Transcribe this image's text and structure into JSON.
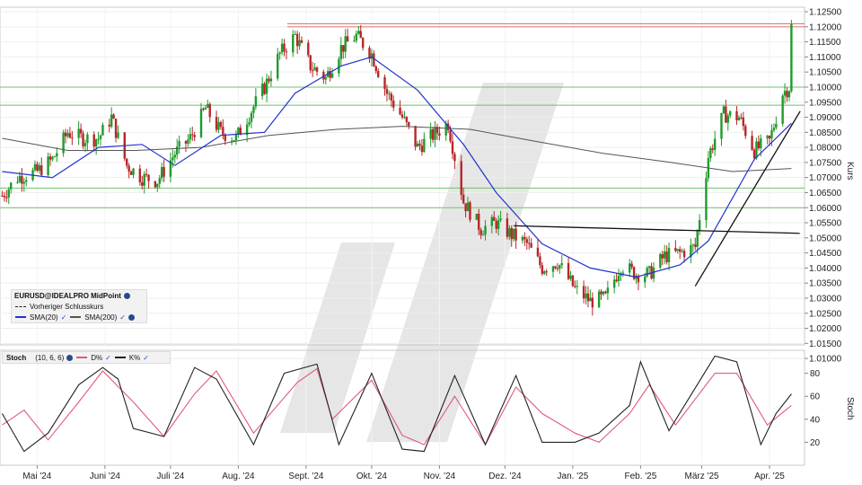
{
  "colors": {
    "bull": "#1f9b2a",
    "bear": "#b8262a",
    "sma20": "#2233cc",
    "sma200": "#555555",
    "support": "#6cc46c",
    "resistance": "#e07070",
    "trendline": "#111111",
    "stoch_k": "#222222",
    "stoch_d": "#e05a78",
    "watermark": "#e6e6e6"
  },
  "legend_main": {
    "title": "EURUSD@IDEALPRO MidPoint",
    "prev_close": "Vorheriger Schlusskurs",
    "sma20": "SMA(20)",
    "sma200": "SMA(200)"
  },
  "legend_stoch": {
    "title": "Stoch",
    "params": "(10, 6, 6)",
    "d_label": "D%",
    "k_label": "K%"
  },
  "chart_data": [
    {
      "type": "candlestick",
      "title": "EURUSD@IDEALPRO MidPoint",
      "ylabel": "Kurs",
      "ylim": [
        1.0145,
        1.1265
      ],
      "yticks": [
        "1.01000",
        "1.01500",
        "1.02000",
        "1.02500",
        "1.03000",
        "1.03500",
        "1.04000",
        "1.04500",
        "1.05000",
        "1.05500",
        "1.06000",
        "1.06500",
        "1.07000",
        "1.07500",
        "1.08000",
        "1.08500",
        "1.09000",
        "1.09500",
        "1.10000",
        "1.10500",
        "1.11000",
        "1.11500",
        "1.12000",
        "1.12500"
      ],
      "xticks": [
        "Mai '24",
        "Juni '24",
        "Juli '24",
        "Aug. '24",
        "Sept. '24",
        "Okt. '24",
        "Nov. '24",
        "Dez. '24",
        "Jan. '25",
        "Feb. '25",
        "März '25",
        "Apr. '25"
      ],
      "close_path": [
        [
          "2024-04-15",
          1.064
        ],
        [
          "2024-04-22",
          1.07
        ],
        [
          "2024-05-01",
          1.072
        ],
        [
          "2024-05-08",
          1.076
        ],
        [
          "2024-05-15",
          1.085
        ],
        [
          "2024-05-22",
          1.083
        ],
        [
          "2024-05-29",
          1.083
        ],
        [
          "2024-06-04",
          1.09
        ],
        [
          "2024-06-11",
          1.074
        ],
        [
          "2024-06-18",
          1.07
        ],
        [
          "2024-06-25",
          1.069
        ],
        [
          "2024-07-03",
          1.078
        ],
        [
          "2024-07-10",
          1.083
        ],
        [
          "2024-07-17",
          1.093
        ],
        [
          "2024-07-24",
          1.085
        ],
        [
          "2024-07-31",
          1.083
        ],
        [
          "2024-08-06",
          1.091
        ],
        [
          "2024-08-13",
          1.1
        ],
        [
          "2024-08-20",
          1.111
        ],
        [
          "2024-08-27",
          1.117
        ],
        [
          "2024-09-03",
          1.107
        ],
        [
          "2024-09-10",
          1.103
        ],
        [
          "2024-09-17",
          1.113
        ],
        [
          "2024-09-24",
          1.117
        ],
        [
          "2024-10-01",
          1.111
        ],
        [
          "2024-10-08",
          1.098
        ],
        [
          "2024-10-15",
          1.09
        ],
        [
          "2024-10-22",
          1.08
        ],
        [
          "2024-10-29",
          1.084
        ],
        [
          "2024-11-05",
          1.088
        ],
        [
          "2024-11-12",
          1.062
        ],
        [
          "2024-11-20",
          1.053
        ],
        [
          "2024-11-27",
          1.055
        ],
        [
          "2024-12-04",
          1.051
        ],
        [
          "2024-12-11",
          1.048
        ],
        [
          "2024-12-18",
          1.04
        ],
        [
          "2024-12-25",
          1.042
        ],
        [
          "2025-01-02",
          1.033
        ],
        [
          "2025-01-09",
          1.029
        ],
        [
          "2025-01-16",
          1.03
        ],
        [
          "2025-01-23",
          1.041
        ],
        [
          "2025-01-30",
          1.038
        ],
        [
          "2025-02-05",
          1.038
        ],
        [
          "2025-02-12",
          1.044
        ],
        [
          "2025-02-19",
          1.045
        ],
        [
          "2025-02-26",
          1.047
        ],
        [
          "2025-03-04",
          1.077
        ],
        [
          "2025-03-11",
          1.091
        ],
        [
          "2025-03-18",
          1.09
        ],
        [
          "2025-03-25",
          1.079
        ],
        [
          "2025-04-01",
          1.082
        ],
        [
          "2025-04-07",
          1.098
        ],
        [
          "2025-04-10",
          1.1
        ],
        [
          "2025-04-11",
          1.12
        ]
      ],
      "sma20_path": [
        [
          "2024-04-15",
          1.072
        ],
        [
          "2024-05-08",
          1.07
        ],
        [
          "2024-05-29",
          1.08
        ],
        [
          "2024-06-18",
          1.081
        ],
        [
          "2024-07-03",
          1.074
        ],
        [
          "2024-07-24",
          1.084
        ],
        [
          "2024-08-13",
          1.085
        ],
        [
          "2024-08-27",
          1.098
        ],
        [
          "2024-09-17",
          1.107
        ],
        [
          "2024-10-01",
          1.11
        ],
        [
          "2024-10-22",
          1.099
        ],
        [
          "2024-11-12",
          1.081
        ],
        [
          "2024-11-27",
          1.065
        ],
        [
          "2024-12-18",
          1.048
        ],
        [
          "2025-01-09",
          1.04
        ],
        [
          "2025-01-30",
          1.037
        ],
        [
          "2025-02-19",
          1.041
        ],
        [
          "2025-03-04",
          1.049
        ],
        [
          "2025-03-25",
          1.076
        ],
        [
          "2025-04-11",
          1.088
        ]
      ],
      "sma200_path": [
        [
          "2024-04-15",
          1.083
        ],
        [
          "2024-05-15",
          1.079
        ],
        [
          "2024-06-15",
          1.079
        ],
        [
          "2024-07-15",
          1.08
        ],
        [
          "2024-08-15",
          1.084
        ],
        [
          "2024-09-15",
          1.086
        ],
        [
          "2024-10-15",
          1.087
        ],
        [
          "2024-11-15",
          1.086
        ],
        [
          "2024-12-15",
          1.082
        ],
        [
          "2025-01-15",
          1.078
        ],
        [
          "2025-02-15",
          1.075
        ],
        [
          "2025-03-15",
          1.072
        ],
        [
          "2025-04-11",
          1.073
        ]
      ],
      "horizontal_levels": {
        "support": [
          1.06,
          1.0665,
          1.094,
          1.1
        ],
        "resistance": [
          1.12,
          1.121
        ]
      },
      "trendlines": [
        {
          "from": [
            "2024-12-05",
            1.054
          ],
          "to": [
            "2025-04-15",
            1.0515
          ]
        },
        {
          "from": [
            "2025-02-26",
            1.034
          ],
          "to": [
            "2025-04-15",
            1.092
          ]
        }
      ]
    },
    {
      "type": "line",
      "title": "Stoch",
      "ylabel": "Stoch",
      "ylim": [
        0,
        100
      ],
      "yticks": [
        "20",
        "40",
        "60",
        "80"
      ],
      "series": [
        {
          "name": "D%",
          "values": [
            [
              "2024-04-15",
              35
            ],
            [
              "2024-04-25",
              48
            ],
            [
              "2024-05-06",
              22
            ],
            [
              "2024-05-20",
              55
            ],
            [
              "2024-05-31",
              82
            ],
            [
              "2024-06-14",
              55
            ],
            [
              "2024-06-28",
              25
            ],
            [
              "2024-07-12",
              62
            ],
            [
              "2024-07-22",
              82
            ],
            [
              "2024-08-08",
              28
            ],
            [
              "2024-08-28",
              72
            ],
            [
              "2024-09-06",
              84
            ],
            [
              "2024-09-13",
              40
            ],
            [
              "2024-10-01",
              74
            ],
            [
              "2024-10-15",
              26
            ],
            [
              "2024-10-25",
              18
            ],
            [
              "2024-11-08",
              60
            ],
            [
              "2024-11-22",
              18
            ],
            [
              "2024-12-06",
              68
            ],
            [
              "2024-12-18",
              45
            ],
            [
              "2025-01-02",
              28
            ],
            [
              "2025-01-13",
              20
            ],
            [
              "2025-01-27",
              45
            ],
            [
              "2025-02-05",
              70
            ],
            [
              "2025-02-17",
              35
            ],
            [
              "2025-03-07",
              80
            ],
            [
              "2025-03-17",
              80
            ],
            [
              "2025-03-31",
              35
            ],
            [
              "2025-04-11",
              52
            ]
          ]
        },
        {
          "name": "K%",
          "values": [
            [
              "2024-04-15",
              45
            ],
            [
              "2024-04-25",
              12
            ],
            [
              "2024-05-06",
              28
            ],
            [
              "2024-05-20",
              70
            ],
            [
              "2024-05-31",
              85
            ],
            [
              "2024-06-07",
              75
            ],
            [
              "2024-06-14",
              32
            ],
            [
              "2024-06-28",
              25
            ],
            [
              "2024-07-12",
              85
            ],
            [
              "2024-07-22",
              75
            ],
            [
              "2024-08-08",
              18
            ],
            [
              "2024-08-22",
              80
            ],
            [
              "2024-09-06",
              88
            ],
            [
              "2024-09-16",
              18
            ],
            [
              "2024-10-01",
              80
            ],
            [
              "2024-10-15",
              14
            ],
            [
              "2024-10-25",
              12
            ],
            [
              "2024-11-08",
              78
            ],
            [
              "2024-11-22",
              18
            ],
            [
              "2024-12-06",
              78
            ],
            [
              "2024-12-18",
              20
            ],
            [
              "2025-01-02",
              20
            ],
            [
              "2025-01-13",
              28
            ],
            [
              "2025-01-27",
              52
            ],
            [
              "2025-02-01",
              90
            ],
            [
              "2025-02-14",
              30
            ],
            [
              "2025-03-07",
              95
            ],
            [
              "2025-03-17",
              90
            ],
            [
              "2025-03-28",
              18
            ],
            [
              "2025-04-04",
              45
            ],
            [
              "2025-04-11",
              62
            ]
          ]
        }
      ]
    }
  ]
}
